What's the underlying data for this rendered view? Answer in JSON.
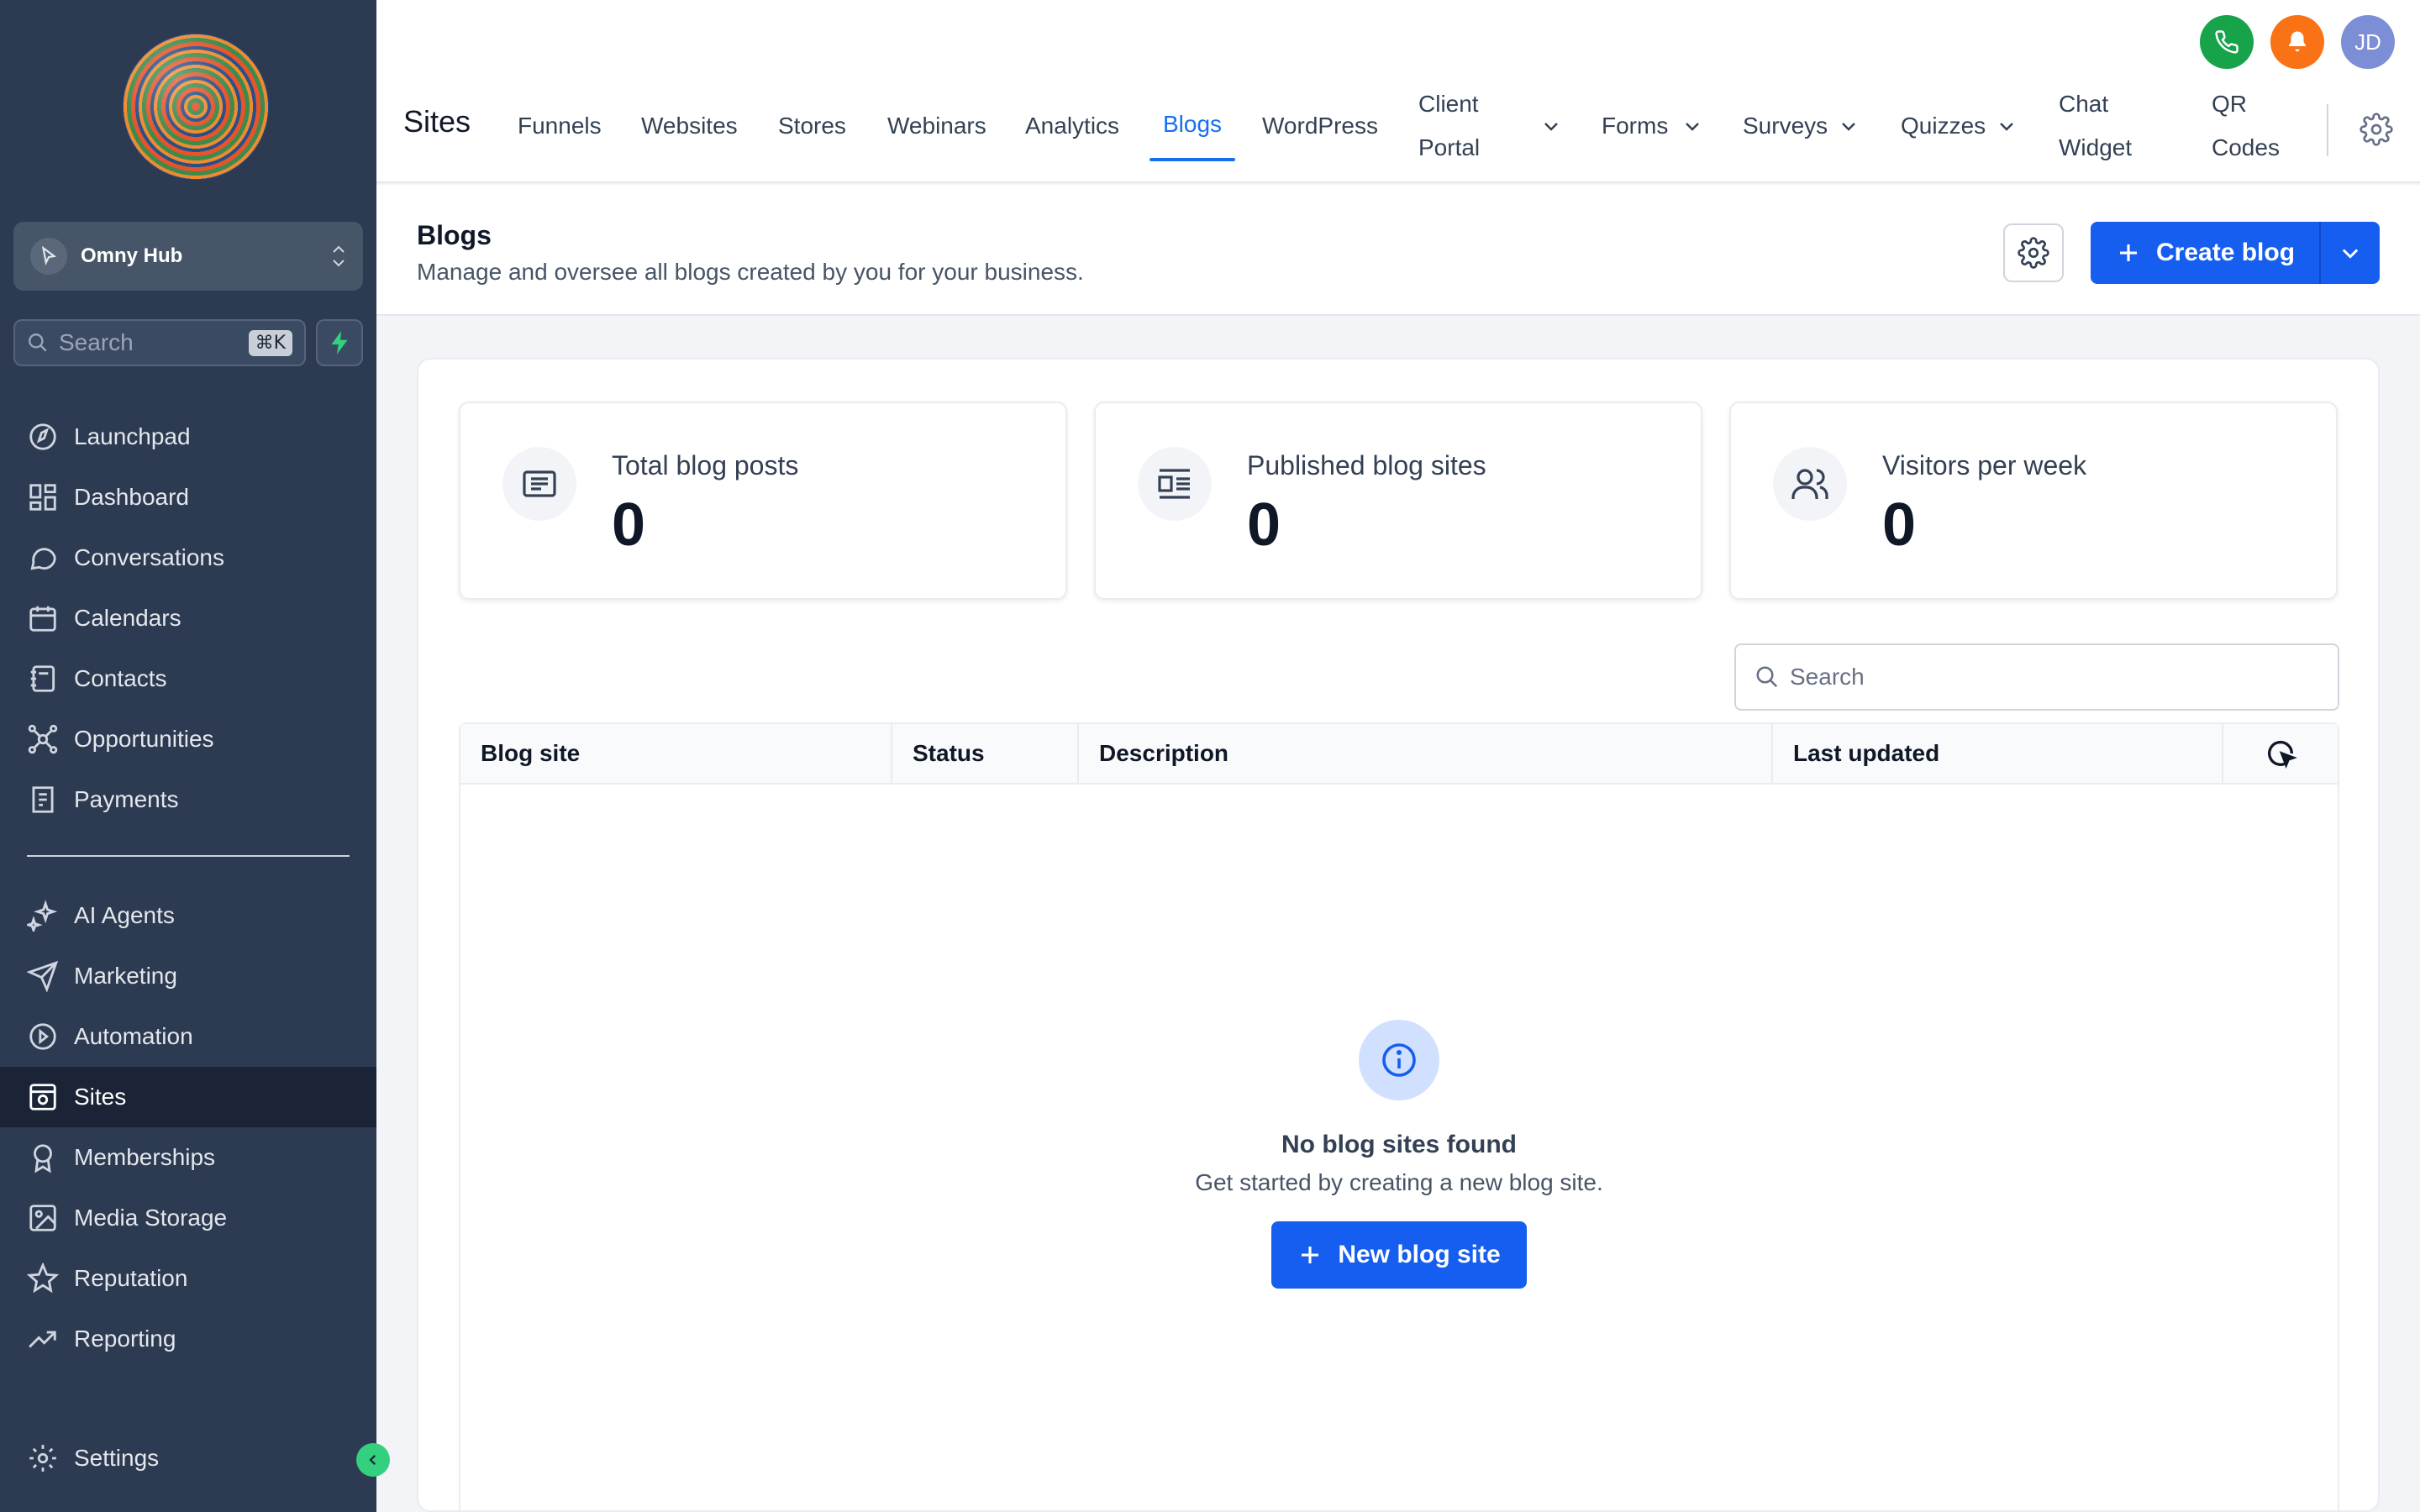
{
  "sidebar": {
    "account_name": "Omny Hub",
    "search_placeholder": "Search",
    "search_shortcut": "⌘K",
    "items_top": [
      {
        "label": "Launchpad",
        "icon": "launchpad-icon"
      },
      {
        "label": "Dashboard",
        "icon": "dashboard-icon"
      },
      {
        "label": "Conversations",
        "icon": "chat-bubble-icon"
      },
      {
        "label": "Calendars",
        "icon": "calendar-icon"
      },
      {
        "label": "Contacts",
        "icon": "contacts-book-icon"
      },
      {
        "label": "Opportunities",
        "icon": "opportunities-icon"
      },
      {
        "label": "Payments",
        "icon": "receipt-icon"
      }
    ],
    "items_bottom": [
      {
        "label": "AI Agents",
        "icon": "sparkles-icon"
      },
      {
        "label": "Marketing",
        "icon": "send-icon"
      },
      {
        "label": "Automation",
        "icon": "automation-icon"
      },
      {
        "label": "Sites",
        "icon": "sites-icon",
        "active": true
      },
      {
        "label": "Memberships",
        "icon": "badge-icon"
      },
      {
        "label": "Media Storage",
        "icon": "image-icon"
      },
      {
        "label": "Reputation",
        "icon": "star-icon"
      },
      {
        "label": "Reporting",
        "icon": "trend-up-icon"
      }
    ],
    "settings_label": "Settings"
  },
  "topbar": {
    "title": "Sites",
    "tabs": {
      "funnels": "Funnels",
      "websites": "Websites",
      "stores": "Stores",
      "webinars": "Webinars",
      "analytics": "Analytics",
      "blogs": "Blogs",
      "wordpress": "WordPress",
      "client_portal_1": "Client",
      "client_portal_2": "Portal",
      "forms": "Forms",
      "surveys": "Surveys",
      "quizzes": "Quizzes",
      "chat_widget_1": "Chat",
      "chat_widget_2": "Widget",
      "qr_codes_1": "QR",
      "qr_codes_2": "Codes"
    },
    "active_tab": "Blogs",
    "avatar_initials": "JD"
  },
  "page": {
    "title": "Blogs",
    "subtitle": "Manage and oversee all blogs created by you for your business.",
    "create_button": "Create blog"
  },
  "stats": [
    {
      "label": "Total blog posts",
      "value": "0",
      "icon": "post-icon"
    },
    {
      "label": "Published blog sites",
      "value": "0",
      "icon": "article-layout-icon"
    },
    {
      "label": "Visitors per week",
      "value": "0",
      "icon": "users-icon"
    }
  ],
  "table": {
    "search_placeholder": "Search",
    "columns": [
      "Blog site",
      "Status",
      "Description",
      "Last updated"
    ],
    "rows": [],
    "empty_title": "No blog sites found",
    "empty_subtitle": "Get started by creating a new blog site.",
    "empty_button": "New blog site"
  },
  "colors": {
    "sidebar_bg": "#2c3a52",
    "primary": "#155eef",
    "active_tab": "#1570ef",
    "phone": "#16a34a",
    "bell": "#f97316",
    "avatar": "#7c8fd6"
  }
}
